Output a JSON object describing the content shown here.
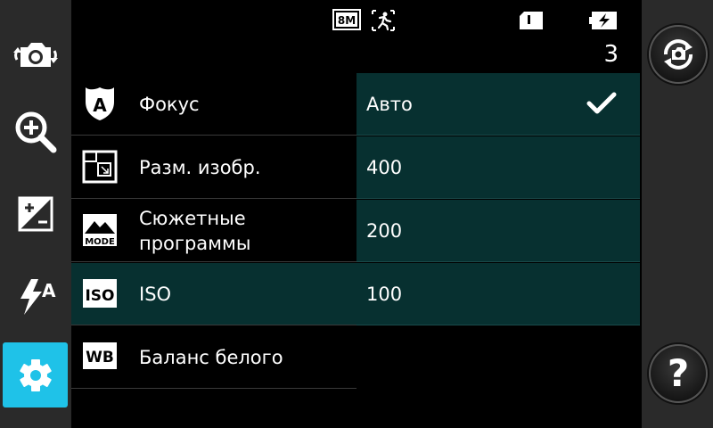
{
  "status": {
    "resolution_badge": "8M",
    "shot_count": "3"
  },
  "menu": {
    "items": [
      {
        "icon": "focus-icon",
        "label": "Фокус",
        "badge": "A"
      },
      {
        "icon": "image-size-icon",
        "label": "Разм. изобр."
      },
      {
        "icon": "scene-mode-icon",
        "label": "Сюжетные\nпрограммы",
        "badge": "MODE"
      },
      {
        "icon": "iso-icon",
        "label": "ISO",
        "badge": "ISO"
      },
      {
        "icon": "white-balance-icon",
        "label": "Баланс белого",
        "badge": "WB"
      }
    ],
    "selected_index": 3
  },
  "options": {
    "items": [
      {
        "label": "Авто",
        "checked": true
      },
      {
        "label": "400"
      },
      {
        "label": "200"
      },
      {
        "label": "100"
      }
    ]
  },
  "left_toolbar": [
    "switch-camera-icon",
    "zoom-icon",
    "exposure-icon",
    "flash-auto-icon",
    "settings-icon"
  ],
  "right_toolbar": [
    "switch-mode-icon",
    "help-icon"
  ],
  "help_label": "?",
  "colors": {
    "accent": "#1fc2e8",
    "panel": "#073030",
    "toolbar": "#2a2a2a"
  }
}
